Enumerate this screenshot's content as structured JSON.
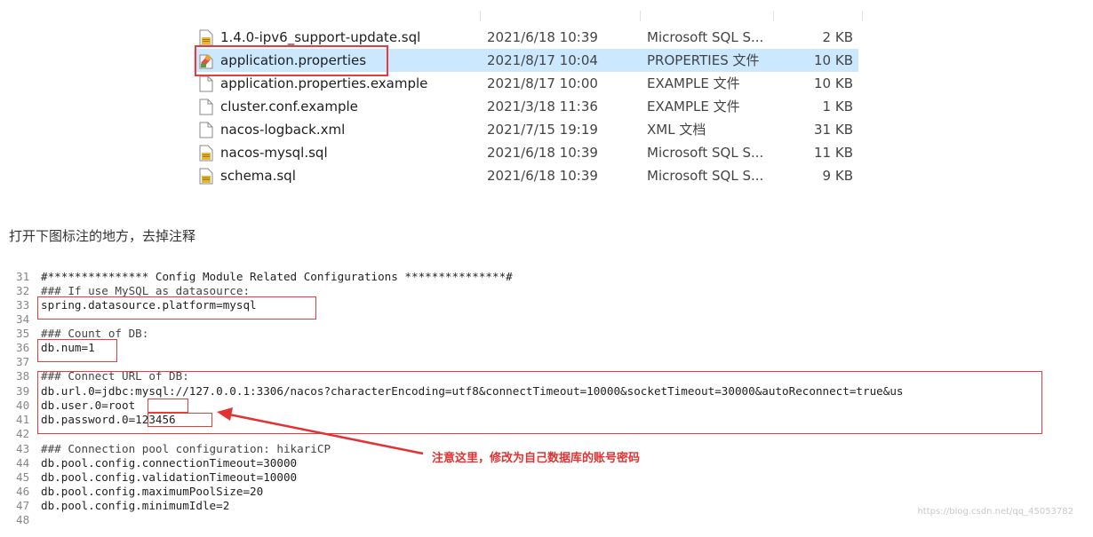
{
  "files": [
    {
      "name": "1.4.0-ipv6_support-update.sql",
      "date": "2021/6/18 10:39",
      "type": "Microsoft SQL S...",
      "size": "2 KB",
      "icon": "sql-file-icon"
    },
    {
      "name": "application.properties",
      "date": "2021/8/17 10:04",
      "type": "PROPERTIES 文件",
      "size": "10 KB",
      "icon": "properties-file-icon",
      "selected": true
    },
    {
      "name": "application.properties.example",
      "date": "2021/8/17 10:00",
      "type": "EXAMPLE 文件",
      "size": "10 KB",
      "icon": "blank-file-icon"
    },
    {
      "name": "cluster.conf.example",
      "date": "2021/3/18 11:36",
      "type": "EXAMPLE 文件",
      "size": "1 KB",
      "icon": "blank-file-icon"
    },
    {
      "name": "nacos-logback.xml",
      "date": "2021/7/15 19:19",
      "type": "XML 文档",
      "size": "31 KB",
      "icon": "blank-file-icon"
    },
    {
      "name": "nacos-mysql.sql",
      "date": "2021/6/18 10:39",
      "type": "Microsoft SQL S...",
      "size": "11 KB",
      "icon": "sql-file-icon"
    },
    {
      "name": "schema.sql",
      "date": "2021/6/18 10:39",
      "type": "Microsoft SQL S...",
      "size": "9 KB",
      "icon": "sql-file-icon"
    }
  ],
  "instruction": "打开下图标注的地方，去掉注释",
  "code_lines": [
    {
      "num": "31",
      "text": "#*************** Config Module Related Configurations ***************#"
    },
    {
      "num": "32",
      "text": "### If use MySQL as datasource:"
    },
    {
      "num": "33",
      "text": "spring.datasource.platform=mysql"
    },
    {
      "num": "34",
      "text": ""
    },
    {
      "num": "35",
      "text": "### Count of DB:"
    },
    {
      "num": "36",
      "text": "db.num=1"
    },
    {
      "num": "37",
      "text": ""
    },
    {
      "num": "38",
      "text": "### Connect URL of DB:"
    },
    {
      "num": "39",
      "text": "db.url.0=jdbc:mysql://127.0.0.1:3306/nacos?characterEncoding=utf8&connectTimeout=10000&socketTimeout=30000&autoReconnect=true&us"
    },
    {
      "num": "40",
      "text": "db.user.0=root"
    },
    {
      "num": "41",
      "text": "db.password.0=123456"
    },
    {
      "num": "42",
      "text": ""
    },
    {
      "num": "43",
      "text": "### Connection pool configuration: hikariCP"
    },
    {
      "num": "44",
      "text": "db.pool.config.connectionTimeout=30000"
    },
    {
      "num": "45",
      "text": "db.pool.config.validationTimeout=10000"
    },
    {
      "num": "46",
      "text": "db.pool.config.maximumPoolSize=20"
    },
    {
      "num": "47",
      "text": "db.pool.config.minimumIdle=2"
    },
    {
      "num": "48",
      "text": ""
    }
  ],
  "annotation": "注意这里，修改为自己数据库的账号密码",
  "watermark": "https://blog.csdn.net/qq_45053782",
  "colors": {
    "highlight_red": "#e43d3d",
    "selection_blue": "#cce8ff",
    "annotation_red": "#e23232"
  }
}
